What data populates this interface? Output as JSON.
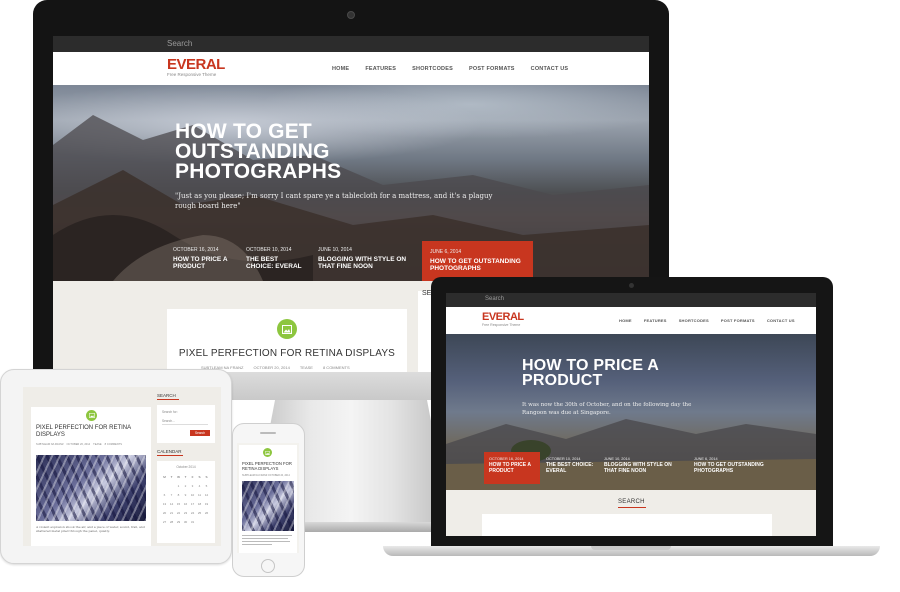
{
  "theme": {
    "accent": "#c8361f",
    "icon_green": "#8dc63f"
  },
  "imac": {
    "search_placeholder": "Search",
    "logo": "EVERAL",
    "tagline": "Free Responsive Theme",
    "nav": [
      "HOME",
      "FEATURES",
      "SHORTCODES",
      "POST FORMATS",
      "CONTACT US"
    ],
    "hero": {
      "title_line1": "HOW TO GET",
      "title_line2": "OUTSTANDING",
      "title_line3": "PHOTOGRAPHS",
      "quote_line1": "\"Just as you please; I'm sorry I cant spare ye a tablecloth for a mattress, and it's a plaguy",
      "quote_line2": "rough board here\""
    },
    "posts": [
      {
        "date": "OCTOBER 16, 2014",
        "title": "HOW TO PRICE A PRODUCT"
      },
      {
        "date": "OCTOBER 10, 2014",
        "title": "THE BEST CHOICE: EVERAL"
      },
      {
        "date": "JUNE 10, 2014",
        "title": "BLOGGING WITH STYLE ON THAT FINE NOON"
      },
      {
        "date": "JUNE 6, 2014",
        "title": "HOW TO GET OUTSTANDING PHOTOGRAPHS"
      }
    ],
    "sidebar_label": "SE",
    "article_title": "PIXEL PERFECTION FOR RETINA DISPLAYS",
    "meta": [
      "SUBTLEAM NA FRANZ",
      "OCTOBER 20, 2014",
      "TEASE",
      "8 COMMENTS"
    ]
  },
  "macbook": {
    "search_placeholder": "Search",
    "logo": "EVERAL",
    "tagline": "Free Responsive Theme",
    "nav": [
      "HOME",
      "FEATURES",
      "SHORTCODES",
      "POST FORMATS",
      "CONTACT US"
    ],
    "hero": {
      "title_line1": "HOW TO PRICE A",
      "title_line2": "PRODUCT",
      "text_line1": "It was now the 30th of October, and on the following day the",
      "text_line2": "Rangoon was due at Singapore."
    },
    "posts": [
      {
        "date": "OCTOBER 16, 2014",
        "title": "HOW TO PRICE A PRODUCT"
      },
      {
        "date": "OCTOBER 10, 2014",
        "title": "THE BEST CHOICE: EVERAL"
      },
      {
        "date": "JUNE 10, 2014",
        "title": "BLOGGING WITH STYLE ON THAT FINE NOON"
      },
      {
        "date": "JUNE 6, 2014",
        "title": "HOW TO GET OUTSTANDING PHOTOGRAPHS"
      }
    ],
    "sidebar_heading": "SEARCH"
  },
  "ipad": {
    "article_title_line1": "PIXEL PERFECTION FOR RETINA",
    "article_title_line2": "DISPLAYS",
    "meta": [
      "SUBTLEAM NA FRANZ",
      "OCTOBER 20, 2014",
      "TEASE",
      "8 COMMENTS"
    ],
    "body_text": "A violent explosion shook the air, and a piece of water, sound, trail, and shattered metal piled through the panel, quietly.",
    "search_heading": "SEARCH",
    "search_label": "Search for:",
    "search_placeholder": "Search...",
    "search_button": "Search",
    "calendar_heading": "CALENDAR",
    "calendar_month": "October 2014",
    "calendar_days": [
      "M",
      "T",
      "W",
      "T",
      "F",
      "S",
      "S"
    ],
    "calendar_rows": [
      [
        "",
        "",
        "1",
        "2",
        "3",
        "4",
        "5"
      ],
      [
        "6",
        "7",
        "8",
        "9",
        "10",
        "11",
        "12"
      ],
      [
        "13",
        "14",
        "15",
        "16",
        "17",
        "18",
        "19"
      ],
      [
        "20",
        "21",
        "22",
        "23",
        "24",
        "25",
        "26"
      ],
      [
        "27",
        "28",
        "29",
        "30",
        "31",
        "",
        ""
      ]
    ]
  },
  "iphone": {
    "article_title_line1": "PIXEL PERFECTION FOR",
    "article_title_line2": "RETINA DISPLAYS",
    "meta": "SUBTLEAM NA FRANZ  OCTOBER 20, 2014"
  }
}
